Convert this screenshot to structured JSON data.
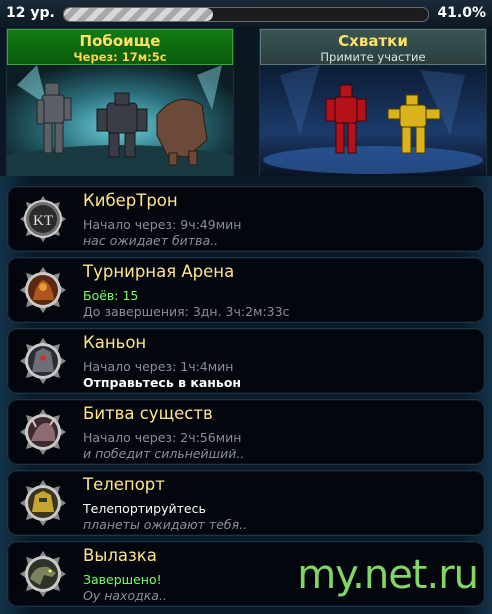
{
  "header": {
    "level": "12 ур.",
    "xp_percent_text": "41.0%",
    "xp_fraction": 0.41
  },
  "modes": [
    {
      "title": "Побоище",
      "subtitle": "Через: 17м:5с"
    },
    {
      "title": "Схватки",
      "subtitle": "Примите участие"
    }
  ],
  "events": [
    {
      "title": "КиберТрон",
      "line2": "Начало через: 9ч:49мин",
      "line3": "нас ожидает битва..",
      "icon": "cybertron-logo-icon"
    },
    {
      "title": "Турнирная Арена",
      "line2": "Боёв: 15",
      "line3": "До завершения: 3дн. 3ч:2м:33с",
      "icon": "arena-robot-icon"
    },
    {
      "title": "Каньон",
      "line2": "Начало через: 1ч:4мин",
      "line3": "Отправьтесь в каньон",
      "icon": "canyon-robot-icon"
    },
    {
      "title": "Битва существ",
      "line2": "Начало через: 2ч:56мин",
      "line3": "и победит сильнейший..",
      "icon": "creature-battle-icon"
    },
    {
      "title": "Телепорт",
      "line2": "Телепортируйтесь",
      "line3": "планеты ожидают тебя..",
      "icon": "teleport-robot-icon"
    },
    {
      "title": "Вылазка",
      "line2": "Завершено!",
      "line3": "Оу находка..",
      "icon": "sortie-dino-icon"
    }
  ],
  "watermark": "my.net.ru",
  "colors": {
    "title_gold": "#ffe58a",
    "green_status": "#7aff6a",
    "mode_green": "#127a14"
  }
}
